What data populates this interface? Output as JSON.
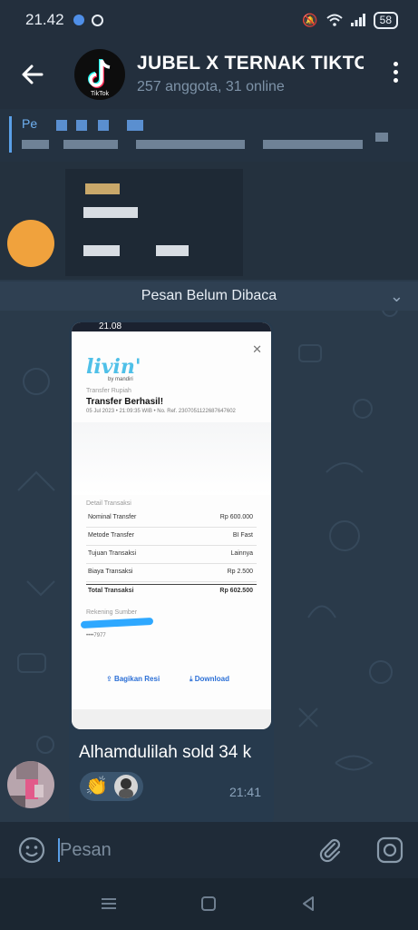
{
  "status_bar": {
    "time": "21.42",
    "battery": "58"
  },
  "header": {
    "title": "JUBEL X TERNAK TIKTOK",
    "subtitle": "257 anggota, 31 online",
    "avatar_text": "TikTok"
  },
  "pinned": {
    "label": "Pe"
  },
  "unread_divider": "Pesan Belum Dibaca",
  "message": {
    "screenshot": {
      "phone_time": "21.08",
      "app_name": "livin'",
      "app_sub": "by mandiri",
      "transfer_label": "Transfer Rupiah",
      "headline": "Transfer Berhasil!",
      "meta": "05 Jul 2023 • 21:09:35 WIB • No. Ref. 2307051122687647602",
      "details_label": "Detail Transaksi",
      "rows": [
        {
          "key": "Nominal Transfer",
          "value": "Rp 600.000"
        },
        {
          "key": "Metode Transfer",
          "value": "BI Fast"
        },
        {
          "key": "Tujuan Transaksi",
          "value": "Lainnya"
        },
        {
          "key": "Biaya Transaksi",
          "value": "Rp 2.500"
        }
      ],
      "total": {
        "key": "Total Transaksi",
        "value": "Rp 602.500"
      },
      "source_label": "Rekening Sumber",
      "account_suffix": "••••7977",
      "share_label": "Bagikan Resi",
      "download_label": "Download"
    },
    "caption": "Alhamdulilah sold 34 k",
    "reaction_emoji": "👏",
    "time": "21:41"
  },
  "composer": {
    "placeholder": "Pesan"
  },
  "colors": {
    "accent": "#5aa0e8",
    "chat_bg": "#2a3a4a",
    "bubble": "#273a4d",
    "header": "#232f3d"
  }
}
